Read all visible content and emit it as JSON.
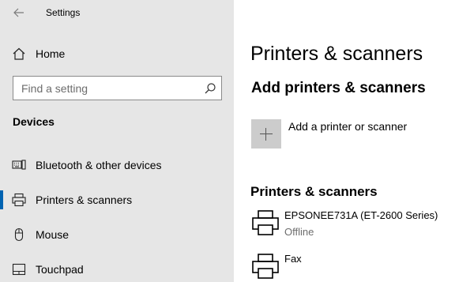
{
  "window": {
    "title": "Settings"
  },
  "sidebar": {
    "home_label": "Home",
    "search_placeholder": "Find a setting",
    "section_label": "Devices",
    "items": [
      {
        "label": "Bluetooth & other devices",
        "icon": "keyboard-icon",
        "selected": false
      },
      {
        "label": "Printers & scanners",
        "icon": "printer-icon",
        "selected": true
      },
      {
        "label": "Mouse",
        "icon": "mouse-icon",
        "selected": false
      },
      {
        "label": "Touchpad",
        "icon": "touchpad-icon",
        "selected": false
      }
    ]
  },
  "main": {
    "title": "Printers & scanners",
    "add_heading": "Add printers & scanners",
    "add_button_label": "Add a printer or scanner",
    "list_heading": "Printers & scanners",
    "printers": [
      {
        "name": "EPSONEE731A (ET-2600 Series)",
        "status": "Offline"
      },
      {
        "name": "Fax",
        "status": ""
      }
    ]
  },
  "colors": {
    "sidebar_bg": "#e6e6e6",
    "accent": "#0063b1",
    "add_button_bg": "#cccccc"
  }
}
